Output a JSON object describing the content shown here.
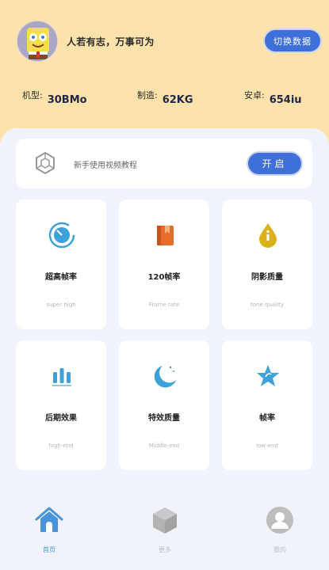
{
  "header": {
    "avatar_name": "spongebob-avatar",
    "motto": "人若有志，万事可为",
    "switch_label": "切换数据",
    "stats": [
      {
        "label": "机型:",
        "value": "30BMo"
      },
      {
        "label": "制造:",
        "value": "62KG"
      },
      {
        "label": "安卓:",
        "value": "654iu"
      }
    ]
  },
  "tutorial": {
    "icon": "hexagon-icon",
    "text": "新手使用视频教程",
    "button_label": "开启"
  },
  "cards": [
    {
      "title": "超高帧率",
      "subtitle": "super high",
      "icon": "speedometer-icon",
      "color": "#3ea1d9"
    },
    {
      "title": "120帧率",
      "subtitle": "Frame rate",
      "icon": "book-icon",
      "color": "#e86d2c"
    },
    {
      "title": "阴影质量",
      "subtitle": "tone quality",
      "icon": "drop-icon",
      "color": "#d7b21c"
    },
    {
      "title": "后期效果",
      "subtitle": "high-end",
      "icon": "bar-chart-icon",
      "color": "#3ea1d9"
    },
    {
      "title": "特效质量",
      "subtitle": "Middle end",
      "icon": "moon-icon",
      "color": "#3ea1d9"
    },
    {
      "title": "帧率",
      "subtitle": "low-end",
      "icon": "star-icon",
      "color": "#3ea1d9"
    }
  ],
  "tabs": [
    {
      "label": "首页",
      "icon": "home-icon",
      "active": true,
      "color": "#4a93d8"
    },
    {
      "label": "更多",
      "icon": "cube-icon",
      "active": false,
      "color": "#bdbdbd"
    },
    {
      "label": "我的",
      "icon": "user-icon",
      "active": false,
      "color": "#bdbdbd"
    }
  ]
}
